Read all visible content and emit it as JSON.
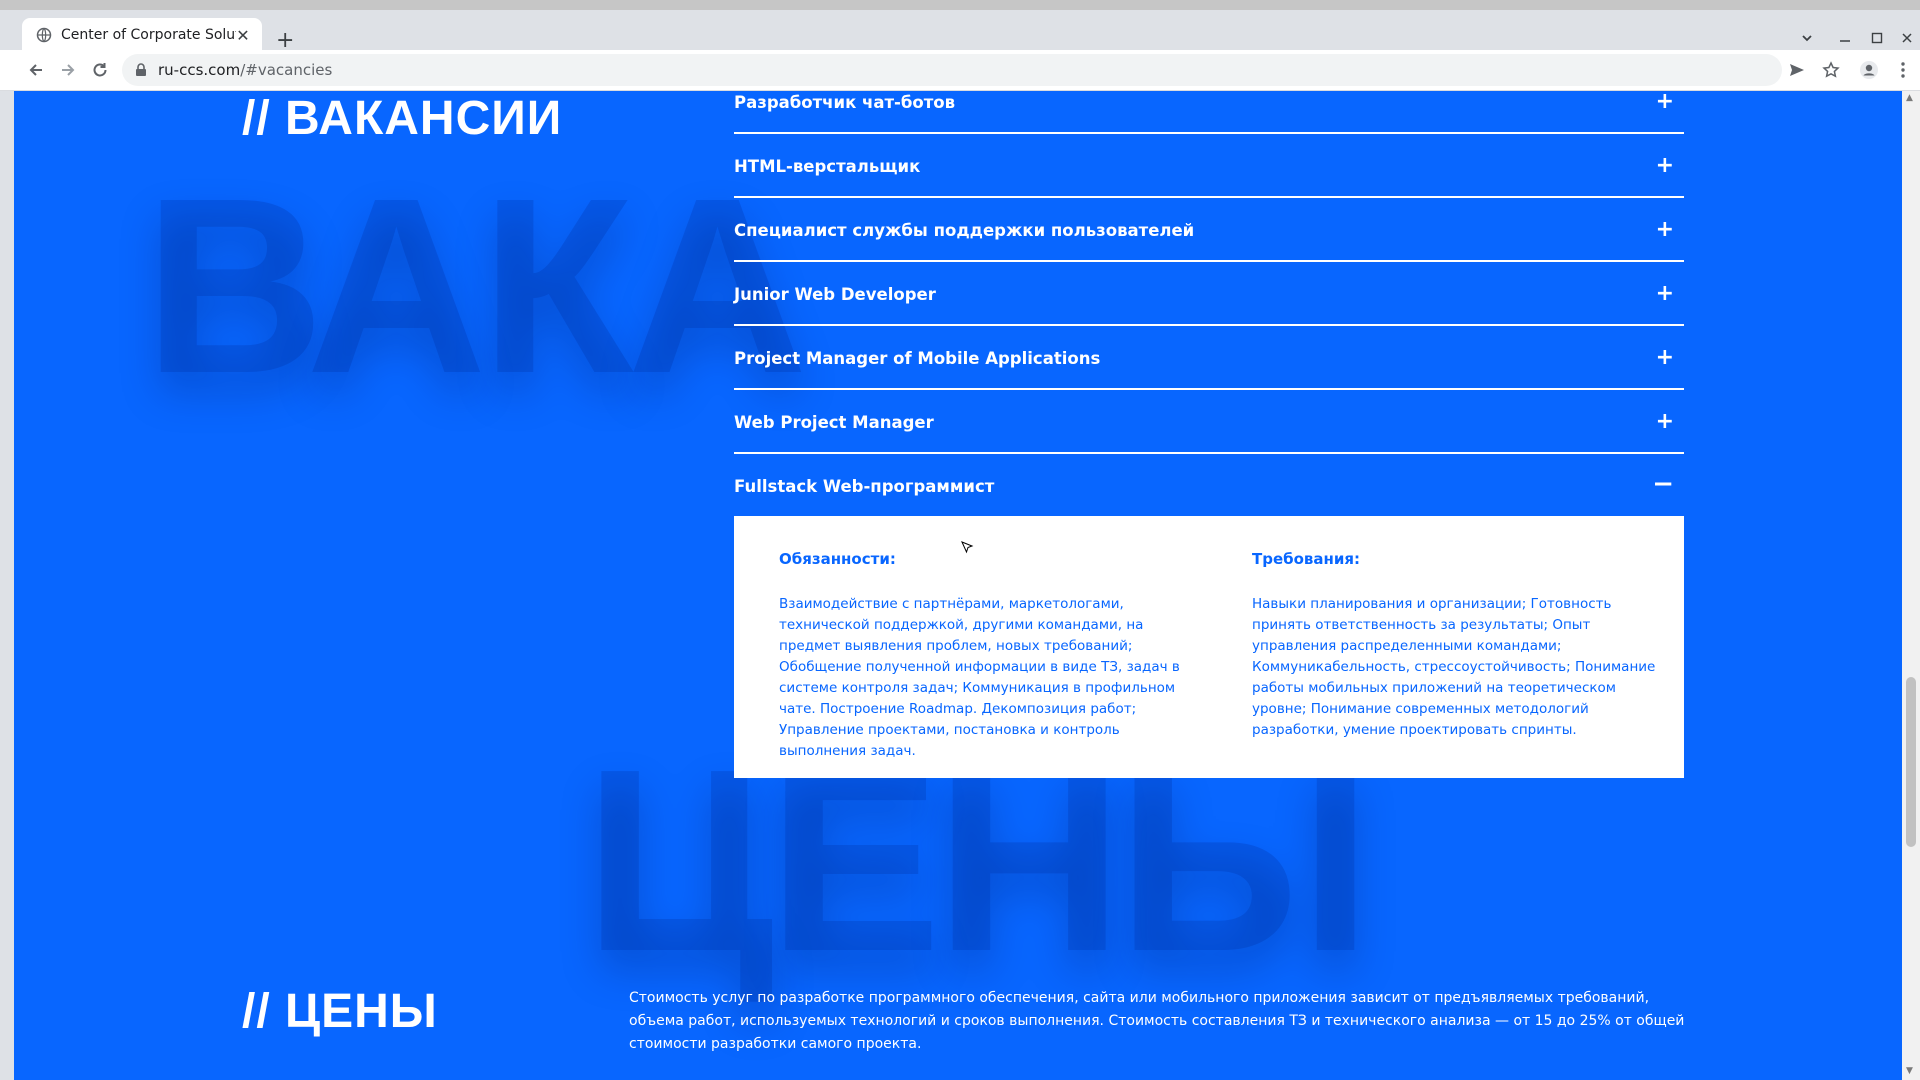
{
  "browser": {
    "tab_title": "Center of Corporate Solutio",
    "url_host": "ru-ccs.com",
    "url_path": "/#vacancies",
    "new_tab_label": "+",
    "close_tab_label": "✕"
  },
  "vacancies": {
    "title": "// ВАКАНСИИ",
    "bg_word": "ВАКА",
    "items": [
      {
        "label": "Разработчик чат-ботов",
        "toggle": "+"
      },
      {
        "label": "HTML-верстальщик",
        "toggle": "+"
      },
      {
        "label": "Специалист службы поддержки пользователей",
        "toggle": "+"
      },
      {
        "label": "Junior Web Developer",
        "toggle": "+"
      },
      {
        "label": "Project Manager of Mobile Applications",
        "toggle": "+"
      },
      {
        "label": "Web Project Manager",
        "toggle": "+"
      },
      {
        "label": "Fullstack Web-программист",
        "toggle": "−"
      }
    ],
    "open_item": {
      "duties_title": "Обязанности:",
      "duties_text": "Взаимодействие с партнёрами, маркетологами, технической поддержкой, другими командами, на предмет выявления проблем, новых требований; Обобщение полученной информации в виде ТЗ, задач в системе контроля задач; Коммуникация в профильном чате. Построение Roadmap. Декомпозиция работ; Управление проектами, постановка и контроль выполнения задач.",
      "req_title": "Требования:",
      "req_text": "Навыки планирования и организации; Готовность принять ответственность за результаты; Опыт управления распределенными командами; Коммуникабельность, стрессоустойчивость; Понимание работы мобильных приложений на теоретическом уровне; Понимание современных методологий разработки, умение проектировать спринты."
    }
  },
  "prices": {
    "title": "// ЦЕНЫ",
    "bg_word": "ЦЕНЫ",
    "text": "Стоимость услуг по разработке программного обеспечения, сайта или мобильного приложения зависит от предъявляемых требований, объема работ, используемых технологий и сроков выполнения. Стоимость составления ТЗ и технического анализа — от 15 до 25% от общей стоимости разработки самого проекта."
  },
  "colors": {
    "page_bg": "#0866ff",
    "accent_text": "#0866ff",
    "white": "#ffffff"
  },
  "icons": [
    "globe-icon",
    "close-icon",
    "back-icon",
    "forward-icon",
    "reload-icon",
    "lock-icon",
    "send-icon",
    "star-icon",
    "profile-icon",
    "menu-icon",
    "minimize-icon",
    "maximize-icon",
    "chevron-down-icon"
  ]
}
